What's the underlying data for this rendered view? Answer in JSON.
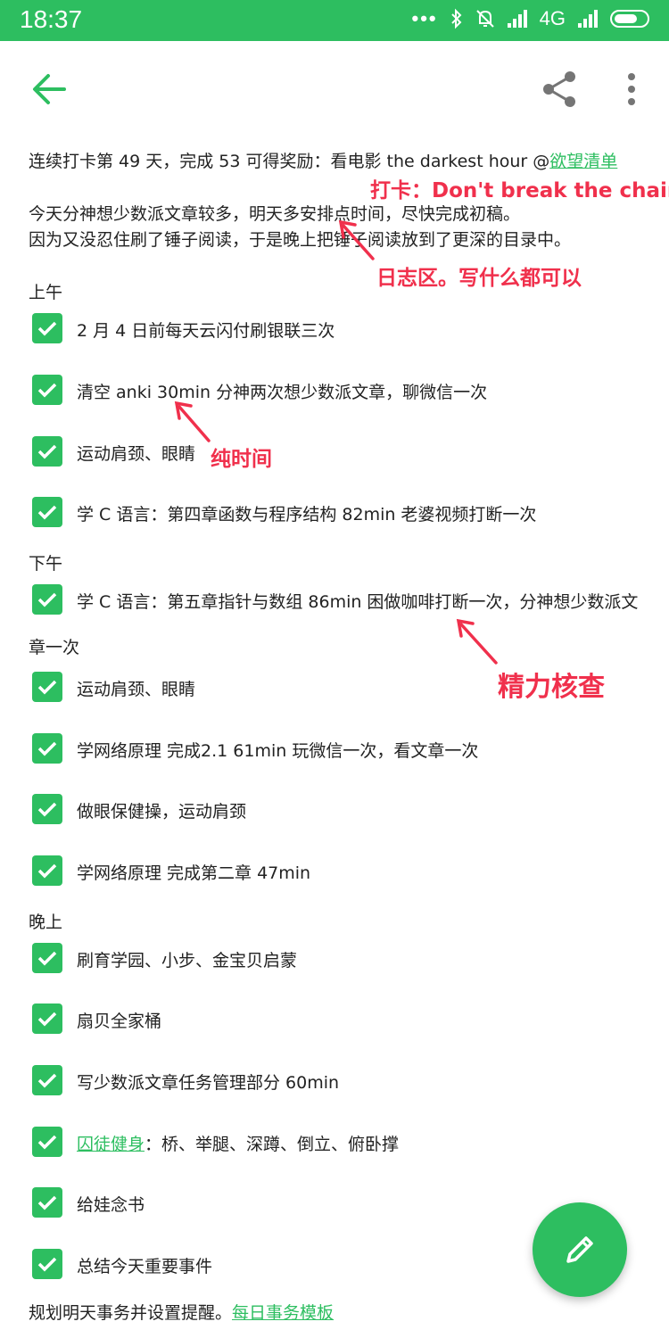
{
  "status_bar": {
    "time": "18:37",
    "network": "4G",
    "icons": [
      "dots-icon",
      "bluetooth-icon",
      "mute-icon",
      "signal-icon",
      "battery-icon"
    ]
  },
  "app_bar": {
    "icons": [
      "back-arrow-icon",
      "share-icon",
      "more-vert-icon"
    ]
  },
  "note": {
    "streak_text": "连续打卡第 49 天，完成 53 可得奖励：看电影 the darkest hour @",
    "streak_link": "欲望清单",
    "journal_line1": "今天分神想少数派文章较多，明天多安排点时间，尽快完成初稿。",
    "journal_line2": "因为又没忍住刷了锤子阅读，于是晚上把锤子阅读放到了更深的目录中。",
    "sections": {
      "morning": "上午",
      "afternoon": "下午",
      "evening": "晚上"
    },
    "morning_tasks": [
      "2 月 4 日前每天云闪付刷银联三次",
      "清空 anki 30min 分神两次想少数派文章，聊微信一次",
      "运动肩颈、眼睛",
      "学 C 语言：第四章函数与程序结构 82min 老婆视频打断一次"
    ],
    "afternoon_task1": "学 C 语言：第五章指针与数组 86min 困做咖啡打断一次，分神想少数派文",
    "afternoon_task1_cont": "章一次",
    "afternoon_tasks": [
      "运动肩颈、眼睛",
      "学网络原理 完成2.1 61min 玩微信一次，看文章一次",
      "做眼保健操，运动肩颈",
      "学网络原理 完成第二章 47min"
    ],
    "evening_tasks": [
      "刷育学园、小步、金宝贝启蒙",
      "扇贝全家桶"
    ],
    "evening_task_more": "写少数派文章任务管理部分 60min",
    "fitness_link": "囚徒健身",
    "fitness_text": "：桥、举腿、深蹲、倒立、俯卧撑",
    "evening_tasks_end": [
      "给娃念书",
      "总结今天重要事件"
    ],
    "footer_text": "规划明天事务并设置提醒。",
    "footer_link": "每日事务模板"
  },
  "annotations": {
    "checkin": "打卡：Don't break the chain.",
    "journal": "日志区。写什么都可以",
    "pure_time": "纯时间",
    "energy": "精力核查",
    "color": "#f0304c"
  },
  "fab": {
    "icon": "edit-pencil-icon"
  },
  "colors": {
    "accent": "#2dbe60"
  }
}
